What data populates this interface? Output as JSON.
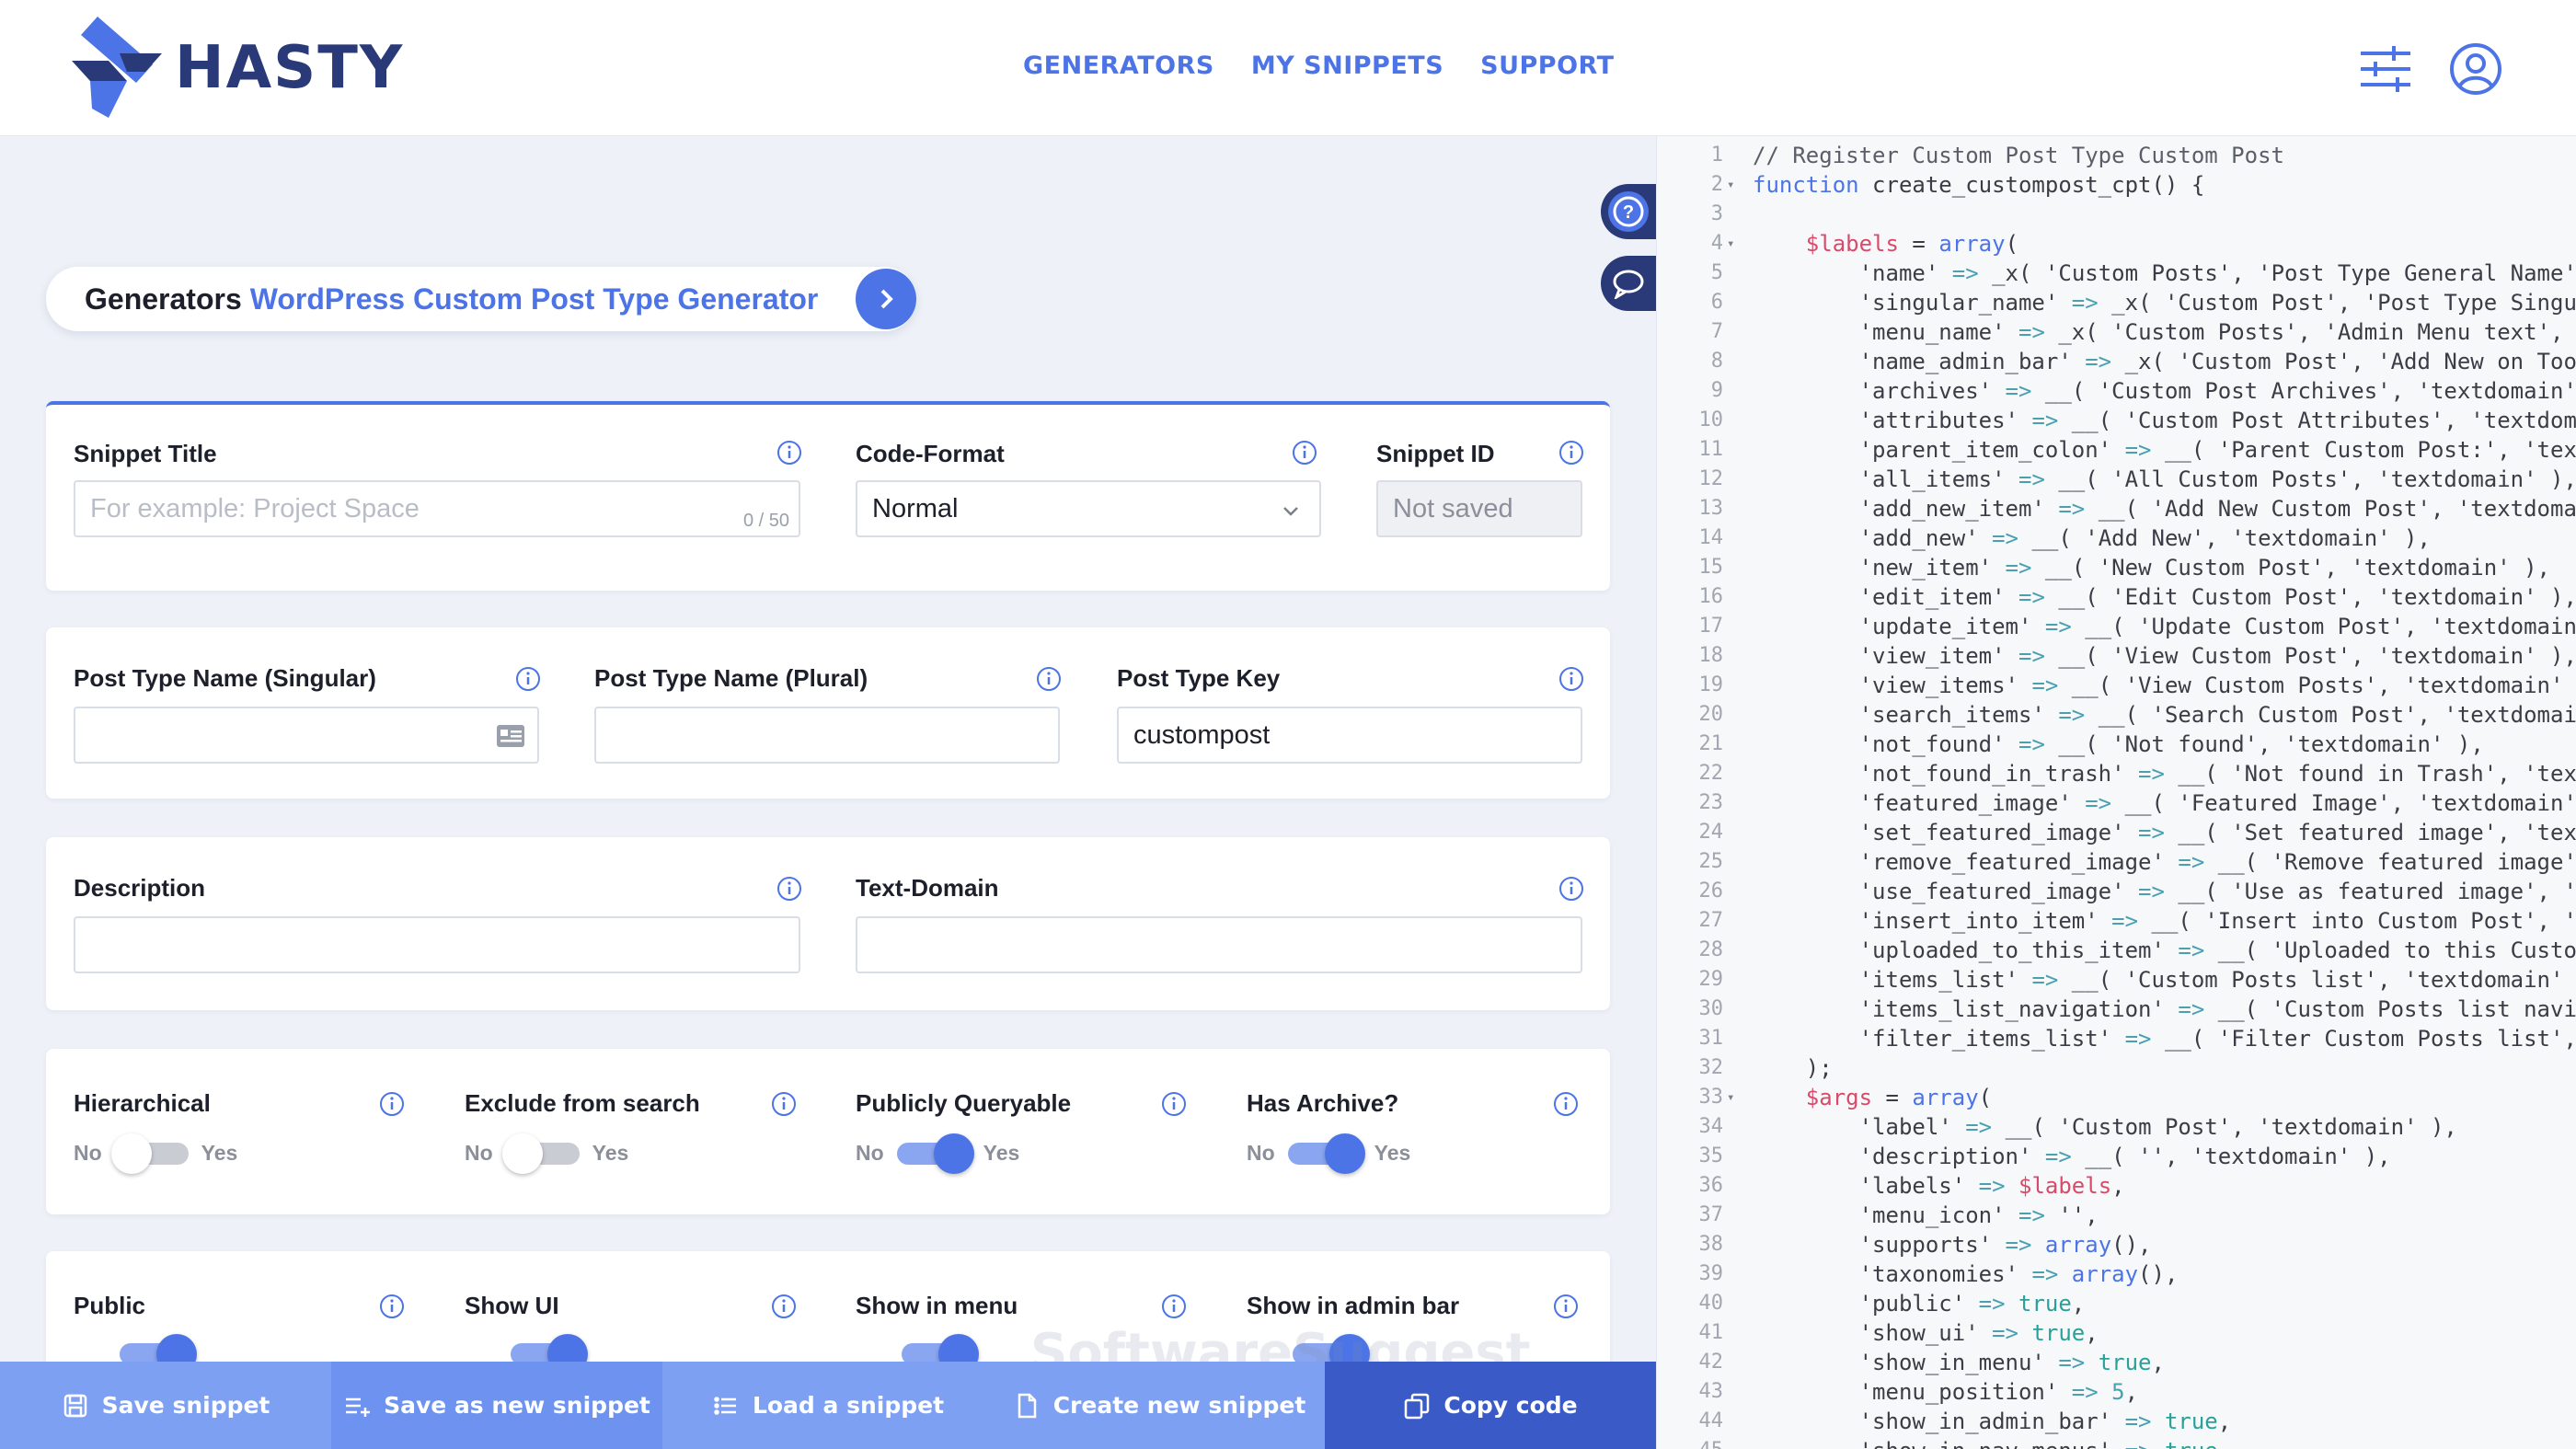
{
  "brand": {
    "name": "HASTY"
  },
  "nav": {
    "items": [
      "GENERATORS",
      "MY SNIPPETS",
      "SUPPORT"
    ]
  },
  "header_icons": [
    "sliders-icon",
    "user-circle-icon"
  ],
  "breadcrumb": {
    "section": "Generators",
    "page": "WordPress Custom Post Type Generator"
  },
  "side_buttons": [
    "help-icon",
    "chat-icon"
  ],
  "form": {
    "snippet_title": {
      "label": "Snippet Title",
      "placeholder": "For example: Project Space",
      "counter": "0 / 50"
    },
    "code_format": {
      "label": "Code-Format",
      "value": "Normal"
    },
    "snippet_id": {
      "label": "Snippet ID",
      "value": "Not saved"
    },
    "post_type_singular": {
      "label": "Post Type Name (Singular)",
      "value": ""
    },
    "post_type_plural": {
      "label": "Post Type Name (Plural)",
      "value": ""
    },
    "post_type_key": {
      "label": "Post Type Key",
      "value": "custompost"
    },
    "description": {
      "label": "Description",
      "value": ""
    },
    "text_domain": {
      "label": "Text-Domain",
      "value": ""
    },
    "toggles_row1": [
      {
        "label": "Hierarchical",
        "on": false,
        "no": "No",
        "yes": "Yes"
      },
      {
        "label": "Exclude from search",
        "on": false,
        "no": "No",
        "yes": "Yes"
      },
      {
        "label": "Publicly Queryable",
        "on": true,
        "no": "No",
        "yes": "Yes"
      },
      {
        "label": "Has Archive?",
        "on": true,
        "no": "No",
        "yes": "Yes"
      }
    ],
    "toggles_row2": [
      {
        "label": "Public",
        "on": true
      },
      {
        "label": "Show UI",
        "on": true
      },
      {
        "label": "Show in menu",
        "on": true
      },
      {
        "label": "Show in admin bar",
        "on": true
      }
    ]
  },
  "toolbar": [
    {
      "label": "Save snippet",
      "icon": "save-icon",
      "bg": "#7ea0f3"
    },
    {
      "label": "Save as new snippet",
      "icon": "list-add-icon",
      "bg": "#6d92f0"
    },
    {
      "label": "Load a snippet",
      "icon": "list-icon",
      "bg": "#7ea0f3"
    },
    {
      "label": "Create new snippet",
      "icon": "file-icon",
      "bg": "#7ea0f3"
    },
    {
      "label": "Copy code",
      "icon": "copy-icon",
      "bg": "#3a5ac8"
    }
  ],
  "watermark": "SoftwareSuggest",
  "colors": {
    "accent": "#4c74e6",
    "brand_dark": "#2a3a78"
  },
  "code": {
    "lines": [
      "// Register Custom Post Type Custom Post",
      "function create_custompost_cpt() {",
      "",
      "\t$labels = array(",
      "\t\t'name' => _x( 'Custom Posts', 'Post Type General Name', 'textdomain' ),",
      "\t\t'singular_name' => _x( 'Custom Post', 'Post Type Singular Name', 'textdomain' ),",
      "\t\t'menu_name' => _x( 'Custom Posts', 'Admin Menu text', 'textdomain' ),",
      "\t\t'name_admin_bar' => _x( 'Custom Post', 'Add New on Toolbar', 'textdomain' ),",
      "\t\t'archives' => __( 'Custom Post Archives', 'textdomain' ),",
      "\t\t'attributes' => __( 'Custom Post Attributes', 'textdomain' ),",
      "\t\t'parent_item_colon' => __( 'Parent Custom Post:', 'textdomain' ),",
      "\t\t'all_items' => __( 'All Custom Posts', 'textdomain' ),",
      "\t\t'add_new_item' => __( 'Add New Custom Post', 'textdomain' ),",
      "\t\t'add_new' => __( 'Add New', 'textdomain' ),",
      "\t\t'new_item' => __( 'New Custom Post', 'textdomain' ),",
      "\t\t'edit_item' => __( 'Edit Custom Post', 'textdomain' ),",
      "\t\t'update_item' => __( 'Update Custom Post', 'textdomain' ),",
      "\t\t'view_item' => __( 'View Custom Post', 'textdomain' ),",
      "\t\t'view_items' => __( 'View Custom Posts', 'textdomain' ),",
      "\t\t'search_items' => __( 'Search Custom Post', 'textdomain' ),",
      "\t\t'not_found' => __( 'Not found', 'textdomain' ),",
      "\t\t'not_found_in_trash' => __( 'Not found in Trash', 'textdomain' ),",
      "\t\t'featured_image' => __( 'Featured Image', 'textdomain' ),",
      "\t\t'set_featured_image' => __( 'Set featured image', 'textdomain' ),",
      "\t\t'remove_featured_image' => __( 'Remove featured image', 'textdomain' ),",
      "\t\t'use_featured_image' => __( 'Use as featured image', 'textdomain' ),",
      "\t\t'insert_into_item' => __( 'Insert into Custom Post', 'textdomain' ),",
      "\t\t'uploaded_to_this_item' => __( 'Uploaded to this Custom Post', 'textdomain' ),",
      "\t\t'items_list' => __( 'Custom Posts list', 'textdomain' ),",
      "\t\t'items_list_navigation' => __( 'Custom Posts list navigation', 'textdomain' ),",
      "\t\t'filter_items_list' => __( 'Filter Custom Posts list', 'textdomain' ),",
      "\t);",
      "\t$args = array(",
      "\t\t'label' => __( 'Custom Post', 'textdomain' ),",
      "\t\t'description' => __( '', 'textdomain' ),",
      "\t\t'labels' => $labels,",
      "\t\t'menu_icon' => '',",
      "\t\t'supports' => array(),",
      "\t\t'taxonomies' => array(),",
      "\t\t'public' => true,",
      "\t\t'show_ui' => true,",
      "\t\t'show_in_menu' => true,",
      "\t\t'menu_position' => 5,",
      "\t\t'show_in_admin_bar' => true,",
      "\t\t'show_in_nav_menus' => true,"
    ],
    "fold_lines": [
      2,
      4,
      33
    ]
  }
}
